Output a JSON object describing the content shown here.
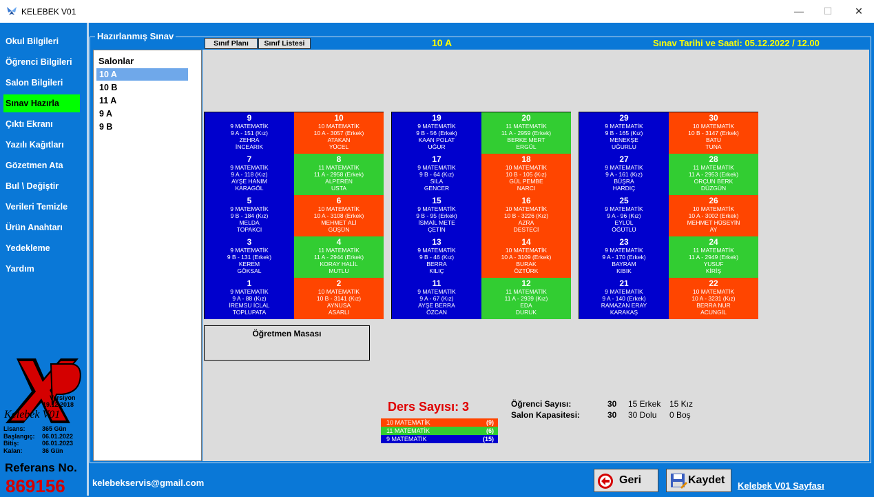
{
  "window": {
    "title": "KELEBEK V01",
    "minimize": "—",
    "maximize": "☐",
    "close": "✕"
  },
  "sidebar": {
    "items": [
      {
        "label": "Okul Bilgileri",
        "active": false
      },
      {
        "label": "Öğrenci Bilgileri",
        "active": false
      },
      {
        "label": "Salon Bilgileri",
        "active": false
      },
      {
        "label": "Sınav Hazırla",
        "active": true
      },
      {
        "label": "Çıktı Ekranı",
        "active": false
      },
      {
        "label": "Yazılı Kağıtları",
        "active": false
      },
      {
        "label": "Gözetmen Ata",
        "active": false
      },
      {
        "label": "Bul \\ Değiştir",
        "active": false
      },
      {
        "label": "Verileri Temizle",
        "active": false
      },
      {
        "label": "Ürün Anahtarı",
        "active": false
      },
      {
        "label": "Yedekleme",
        "active": false
      },
      {
        "label": "Yardım",
        "active": false
      }
    ],
    "logo": {
      "version_label": "Versiyon",
      "version_date": "19.12.2018",
      "product_name": "Kelebek V01"
    },
    "license": [
      {
        "label": "Lisans:",
        "value": "365 Gün"
      },
      {
        "label": "Başlangıç:",
        "value": "06.01.2022"
      },
      {
        "label": "Bitiş:",
        "value": "06.01.2023"
      },
      {
        "label": "Kalan:",
        "value": "36 Gün"
      }
    ],
    "reference_label": "Referans No.",
    "reference_value": "869156"
  },
  "group_title": "Hazırlanmış Sınav",
  "salons": {
    "header": "Salonlar",
    "items": [
      "10 A",
      "10 B",
      "11 A",
      "9 A",
      "9 B"
    ],
    "selected": "10 A"
  },
  "tabs": {
    "plan": "Sınıf Planı",
    "list": "Sınıf Listesi"
  },
  "room_title": "10 A",
  "exam_date": "Sınav Tarihi ve Saati: 05.12.2022 / 12.00",
  "seats": [
    {
      "no": "9",
      "ders": "9 MATEMATİK",
      "info": "9 A - 151 (Kız)",
      "name": "ZEHRA",
      "surname": "İNCEARIK",
      "color": "blue"
    },
    {
      "no": "10",
      "ders": "10 MATEMATİK",
      "info": "10 A - 3057 (Erkek)",
      "name": "ATAKAN",
      "surname": "YÜCEL",
      "color": "orange"
    },
    {
      "no": "7",
      "ders": "9 MATEMATİK",
      "info": "9 A - 118 (Kız)",
      "name": "AYŞE HANIM",
      "surname": "KARAGÖL",
      "color": "blue"
    },
    {
      "no": "8",
      "ders": "11 MATEMATİK",
      "info": "11 A - 2958 (Erkek)",
      "name": "ALPEREN",
      "surname": "USTA",
      "color": "green"
    },
    {
      "no": "5",
      "ders": "9 MATEMATİK",
      "info": "9 B - 184 (Kız)",
      "name": "MELDA",
      "surname": "TOPAKCI",
      "color": "blue"
    },
    {
      "no": "6",
      "ders": "10 MATEMATİK",
      "info": "10 A - 3108 (Erkek)",
      "name": "MEHMET ALİ",
      "surname": "GÜŞÜN",
      "color": "orange"
    },
    {
      "no": "3",
      "ders": "9 MATEMATİK",
      "info": "9 B - 131 (Erkek)",
      "name": "KEREM",
      "surname": "GÖKSAL",
      "color": "blue"
    },
    {
      "no": "4",
      "ders": "11 MATEMATİK",
      "info": "11 A - 2944 (Erkek)",
      "name": "KORAY HALİL",
      "surname": "MUTLU",
      "color": "green"
    },
    {
      "no": "1",
      "ders": "9 MATEMATİK",
      "info": "9 A - 88 (Kız)",
      "name": "İREMSU İCLAL",
      "surname": "TOPLUPATA",
      "color": "blue"
    },
    {
      "no": "2",
      "ders": "10 MATEMATİK",
      "info": "10 B - 3141 (Kız)",
      "name": "AYNUSA",
      "surname": "ASARLI",
      "color": "orange"
    },
    {
      "no": "19",
      "ders": "9 MATEMATİK",
      "info": "9 B - 56 (Erkek)",
      "name": "KAAN POLAT",
      "surname": "UĞUR",
      "color": "blue"
    },
    {
      "no": "20",
      "ders": "11 MATEMATİK",
      "info": "11 A - 2959 (Erkek)",
      "name": "BERKE MERT",
      "surname": "ERGÜL",
      "color": "green"
    },
    {
      "no": "17",
      "ders": "9 MATEMATİK",
      "info": "9 B - 64 (Kız)",
      "name": "SILA",
      "surname": "GENCER",
      "color": "blue"
    },
    {
      "no": "18",
      "ders": "10 MATEMATİK",
      "info": "10 B - 105 (Kız)",
      "name": "GÜL PEMBE",
      "surname": "NARCI",
      "color": "orange"
    },
    {
      "no": "15",
      "ders": "9 MATEMATİK",
      "info": "9 B - 95 (Erkek)",
      "name": "İSMAİL METE",
      "surname": "ÇETİN",
      "color": "blue"
    },
    {
      "no": "16",
      "ders": "10 MATEMATİK",
      "info": "10 B - 3226 (Kız)",
      "name": "AZRA",
      "surname": "DESTECİ",
      "color": "orange"
    },
    {
      "no": "13",
      "ders": "9 MATEMATİK",
      "info": "9 B - 46 (Kız)",
      "name": "BERRA",
      "surname": "KILIÇ",
      "color": "blue"
    },
    {
      "no": "14",
      "ders": "10 MATEMATİK",
      "info": "10 A - 3109 (Erkek)",
      "name": "BURAK",
      "surname": "ÖZTÜRK",
      "color": "orange"
    },
    {
      "no": "11",
      "ders": "9 MATEMATİK",
      "info": "9 A - 67 (Kız)",
      "name": "AYŞE BERRA",
      "surname": "ÖZCAN",
      "color": "blue"
    },
    {
      "no": "12",
      "ders": "11 MATEMATİK",
      "info": "11 A - 2939 (Kız)",
      "name": "EDA",
      "surname": "DURUK",
      "color": "green"
    },
    {
      "no": "29",
      "ders": "9 MATEMATİK",
      "info": "9 B - 165 (Kız)",
      "name": "MENEKŞE",
      "surname": "UĞURLU",
      "color": "blue"
    },
    {
      "no": "30",
      "ders": "10 MATEMATİK",
      "info": "10 B - 3147 (Erkek)",
      "name": "BATU",
      "surname": "TUNA",
      "color": "orange"
    },
    {
      "no": "27",
      "ders": "9 MATEMATİK",
      "info": "9 A - 161 (Kız)",
      "name": "BÜŞRA",
      "surname": "HARDIÇ",
      "color": "blue"
    },
    {
      "no": "28",
      "ders": "11 MATEMATİK",
      "info": "11 A - 2953 (Erkek)",
      "name": "ORÇUN BERK",
      "surname": "DÜZGÜN",
      "color": "green"
    },
    {
      "no": "25",
      "ders": "9 MATEMATİK",
      "info": "9 A - 96 (Kız)",
      "name": "EYLÜL",
      "surname": "ÖĞÜTLÜ",
      "color": "blue"
    },
    {
      "no": "26",
      "ders": "10 MATEMATİK",
      "info": "10 A - 3002 (Erkek)",
      "name": "MEHMET HÜSEYİN",
      "surname": "AY",
      "color": "orange"
    },
    {
      "no": "23",
      "ders": "9 MATEMATİK",
      "info": "9 A - 170 (Erkek)",
      "name": "BAYRAM",
      "surname": "KIBIK",
      "color": "blue"
    },
    {
      "no": "24",
      "ders": "11 MATEMATİK",
      "info": "11 A - 2949 (Erkek)",
      "name": "YUSUF",
      "surname": "KİRİŞ",
      "color": "green"
    },
    {
      "no": "21",
      "ders": "9 MATEMATİK",
      "info": "9 A - 140 (Erkek)",
      "name": "RAMAZAN ERAY",
      "surname": "KARAKAŞ",
      "color": "blue"
    },
    {
      "no": "22",
      "ders": "10 MATEMATİK",
      "info": "10 A - 3231 (Kız)",
      "name": "BERRA NUR",
      "surname": "ACUNGİL",
      "color": "orange"
    }
  ],
  "teacher_desk": "Öğretmen Masası",
  "summary": {
    "ders_label": "Ders Sayısı: 3",
    "legend": [
      {
        "name": "10 MATEMATİK",
        "count": "(9)",
        "color": "#ff4500"
      },
      {
        "name": "11 MATEMATİK",
        "count": "(6)",
        "color": "#32cd32"
      },
      {
        "name": "9 MATEMATİK",
        "count": "(15)",
        "color": "#0000cd"
      }
    ],
    "ogrenci_label": "Öğrenci Sayısı:",
    "ogrenci_count": "30",
    "erkek": "15 Erkek",
    "kiz": "15 Kız",
    "kapasite_label": "Salon Kapasitesi:",
    "kapasite_count": "30",
    "dolu": "30 Dolu",
    "bos": "0 Boş"
  },
  "footer": {
    "email": "kelebekservis@gmail.com",
    "back_label": "Geri",
    "save_label": "Kaydet",
    "link": "Kelebek V01 Sayfası"
  }
}
